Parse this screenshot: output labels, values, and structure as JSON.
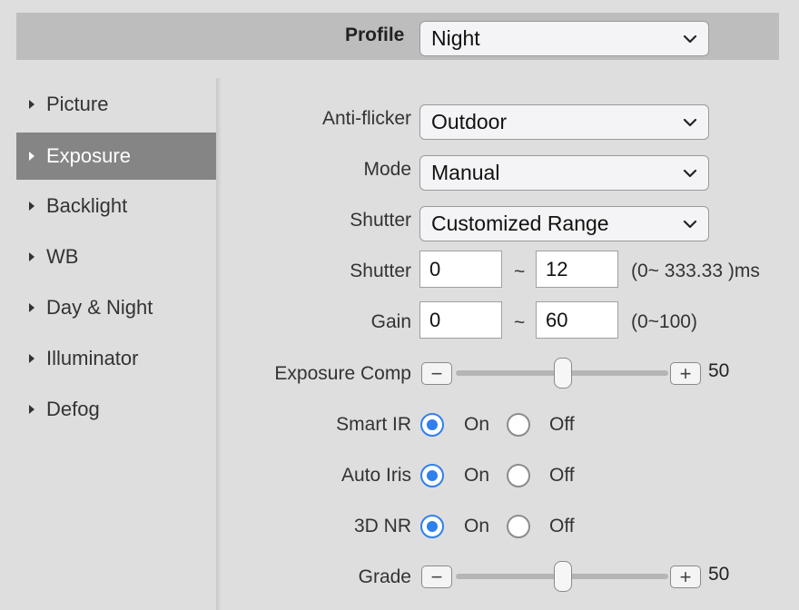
{
  "header": {
    "profile_label": "Profile",
    "profile_value": "Night"
  },
  "sidebar": {
    "items": [
      {
        "label": "Picture"
      },
      {
        "label": "Exposure"
      },
      {
        "label": "Backlight"
      },
      {
        "label": "WB"
      },
      {
        "label": "Day & Night"
      },
      {
        "label": "Illuminator"
      },
      {
        "label": "Defog"
      }
    ],
    "active": "Exposure"
  },
  "form": {
    "anti_flicker": {
      "label": "Anti-flicker",
      "value": "Outdoor"
    },
    "mode": {
      "label": "Mode",
      "value": "Manual"
    },
    "shutter_mode": {
      "label": "Shutter",
      "value": "Customized Range"
    },
    "shutter_range": {
      "label": "Shutter",
      "min": "0",
      "separator": "~",
      "max": "12",
      "note": "(0~ 333.33 )ms"
    },
    "gain": {
      "label": "Gain",
      "min": "0",
      "separator": "~",
      "max": "60",
      "note": "(0~100)"
    },
    "exposure_comp": {
      "label": "Exposure Comp",
      "minus": "−",
      "plus": "+",
      "value": "50"
    },
    "smart_ir": {
      "label": "Smart IR",
      "on_label": "On",
      "off_label": "Off",
      "selected": "On"
    },
    "auto_iris": {
      "label": "Auto Iris",
      "on_label": "On",
      "off_label": "Off",
      "selected": "On"
    },
    "nr_3d": {
      "label": "3D NR",
      "on_label": "On",
      "off_label": "Off",
      "selected": "On"
    },
    "grade": {
      "label": "Grade",
      "minus": "−",
      "plus": "+",
      "value": "50"
    }
  },
  "icons": {
    "dropdown": "chevron-down-icon",
    "sidebar_item": "triangle-right-icon"
  },
  "colors": {
    "accent": "#2f80ed",
    "active_item_bg": "#858585",
    "header_bg": "#bdbdbd"
  }
}
